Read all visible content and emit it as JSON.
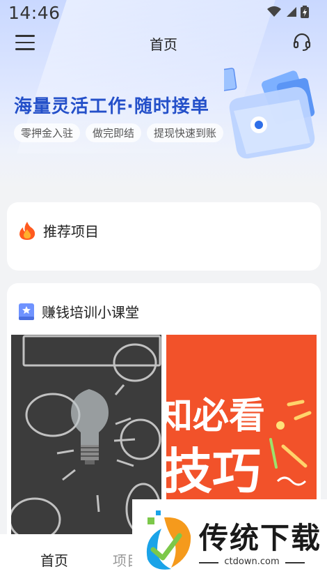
{
  "status": {
    "time": "14:46"
  },
  "nav": {
    "title": "首页",
    "menu_icon": "menu-icon",
    "support_icon": "headset-icon"
  },
  "banner": {
    "title": "海量灵活工作·随时接单",
    "tags": [
      "零押金入驻",
      "做完即结",
      "提现快速到账"
    ]
  },
  "recommended": {
    "icon": "fire-icon",
    "label": "推荐项目"
  },
  "training": {
    "icon": "book-icon",
    "label": "赚钱培训小课堂",
    "thumb2_line1": "知必看",
    "thumb2_line2": "技巧"
  },
  "tabs": {
    "home": "首页",
    "projects": "项目"
  },
  "watermark": {
    "brand": "传统下载",
    "url": "ctdown.com"
  },
  "colors": {
    "accent": "#2450c9",
    "orange": "#f2522a",
    "fire": "#ff6a1a"
  }
}
